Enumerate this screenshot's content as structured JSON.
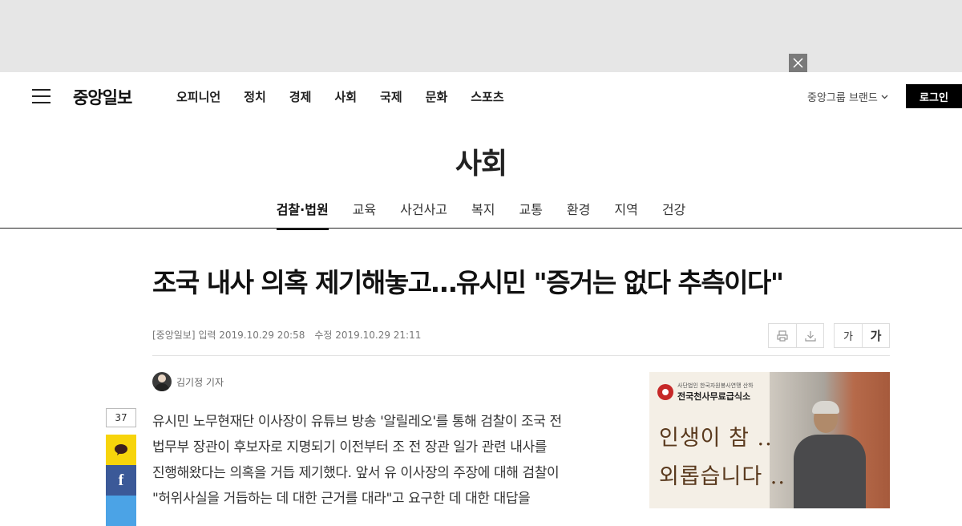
{
  "header": {
    "logo": "중앙일보",
    "nav": [
      "오피니언",
      "정치",
      "경제",
      "사회",
      "국제",
      "문화",
      "스포츠"
    ],
    "brand_menu": "중앙그룹 브랜드",
    "login": "로그인"
  },
  "section": {
    "title": "사회",
    "subnav": [
      "검찰·법원",
      "교육",
      "사건사고",
      "복지",
      "교통",
      "환경",
      "지역",
      "건강"
    ],
    "active_subnav": "검찰·법원"
  },
  "article": {
    "headline": "조국 내사 의혹 제기해놓고…유시민 \"증거는 없다 추측이다\"",
    "source": "[중앙일보]",
    "published": "입력 2019.10.29 20:58",
    "updated": "수정 2019.10.29 21:11",
    "reporter": "김기정 기자",
    "font_small": "가",
    "font_large": "가",
    "paragraphs": [
      "유시민 노무현재단 이사장이 유튜브 방송 '알릴레오'를 통해 검찰이 조국 전",
      "법무부 장관이 후보자로 지명되기 이전부터 조 전 장관 일가 관련 내사를",
      "진행해왔다는 의혹을 거듭 제기했다. 앞서 유 이사장의 주장에 대해 검찰이",
      "\"허위사실을 거듭하는 데 대한 근거를 대라\"고 요구한 데 대한 대답을"
    ]
  },
  "share": {
    "count": "37",
    "facebook": "f"
  },
  "side_ad": {
    "org_small": "사단법인 한국자원봉사연맹 산하",
    "org_name": "전국천사무료급식소",
    "line1": "인생이 참 ..",
    "line2": "외롭습니다 .."
  }
}
